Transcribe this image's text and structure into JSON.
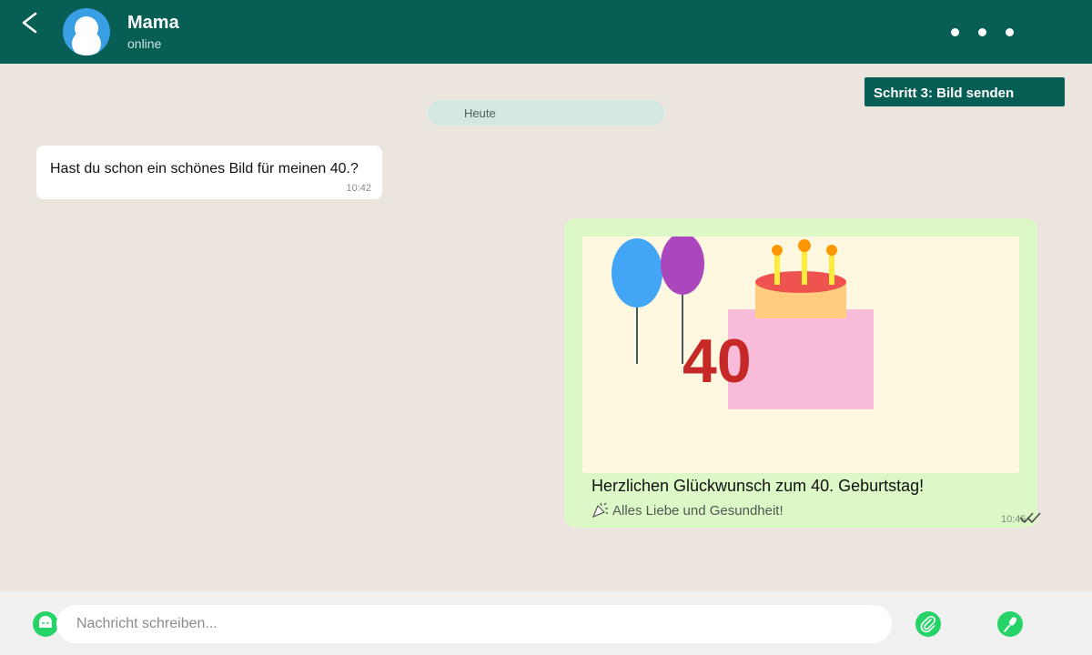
{
  "header": {
    "back_icon": "chevron-left-icon",
    "avatar_icon": "user-silhouette-icon",
    "contact_name": "Mama",
    "contact_status": "online",
    "menu_icon": "more-dots-icon",
    "background_color": "#075e54"
  },
  "step_badge": {
    "label": "Schritt 3: Bild senden"
  },
  "chat": {
    "background_color": "#ece5de",
    "date_separator": "Heute",
    "incoming": {
      "text": "Hast du schon ein schönes Bild für meinen 40.?",
      "time": "10:42"
    },
    "outgoing": {
      "bubble_color": "#dcf8c6",
      "image": {
        "number_text": "40",
        "elements": [
          "balloon-blue",
          "balloon-purple",
          "birthday-cake",
          "candles"
        ]
      },
      "caption": "Herzlichen Glückwunsch zum 40. Geburtstag!",
      "subcaption_icon": "party-popper-icon",
      "subcaption": "Alles Liebe und Gesundheit!",
      "time": "10:45",
      "status_icon": "double-check-icon"
    }
  },
  "composer": {
    "emoji_icon": "emoji-icon",
    "placeholder": "Nachricht schreiben...",
    "value": "",
    "attach_icon": "paperclip-icon",
    "mic_icon": "microphone-icon",
    "accent_color": "#25d366"
  }
}
